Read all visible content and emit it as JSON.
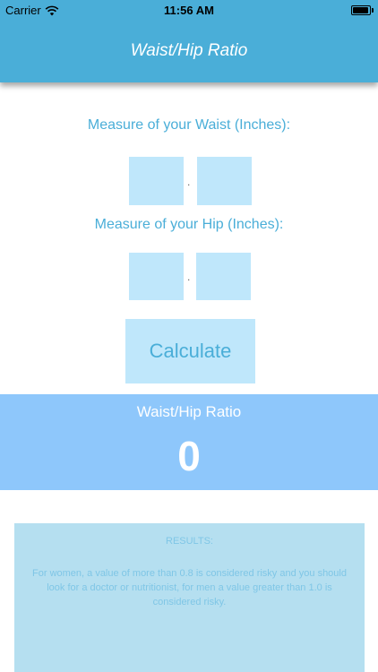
{
  "status_bar": {
    "carrier": "Carrier",
    "time": "11:56 AM",
    "icons": [
      "wifi-icon",
      "battery-icon"
    ]
  },
  "nav": {
    "title": "Waist/Hip Ratio"
  },
  "waist": {
    "label": "Measure of your Waist (Inches):",
    "whole_value": "",
    "decimal_value": "",
    "separator": "."
  },
  "hip": {
    "label": "Measure of your Hip (Inches):",
    "whole_value": "",
    "decimal_value": "",
    "separator": "."
  },
  "calculate": {
    "label": "Calculate"
  },
  "ratio": {
    "title": "Waist/Hip Ratio",
    "value": "0"
  },
  "results": {
    "heading": "RESULTS:",
    "text": "For women, a value of more than 0.8 is considered risky and you should look for a doctor or nutritionist, for men a value greater than 1.0 is considered risky."
  },
  "colors": {
    "accent": "#4aaed8",
    "input_bg": "#bfe7fb",
    "ratio_bg": "#8ec7fb",
    "results_bg": "#b5dff0"
  }
}
